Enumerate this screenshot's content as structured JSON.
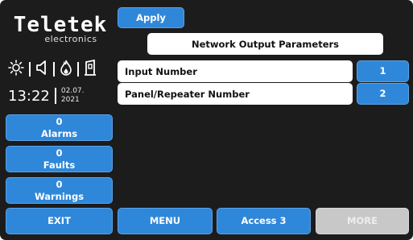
{
  "brand": {
    "name": "Teletek",
    "subtitle": "electronics"
  },
  "status_icons": [
    "sun-icon",
    "buzzer-icon",
    "fire-icon",
    "door-icon"
  ],
  "clock": {
    "time": "13:22",
    "date_line1": "02.07.",
    "date_line2": "2021"
  },
  "counters": {
    "alarms": {
      "count": "0",
      "label": "Alarms"
    },
    "faults": {
      "count": "0",
      "label": "Faults"
    },
    "warnings": {
      "count": "0",
      "label": "Warnings"
    }
  },
  "toolbar": {
    "apply_label": "Apply"
  },
  "page": {
    "title": "Network Output Parameters"
  },
  "params": [
    {
      "label": "Input Number",
      "value": "1"
    },
    {
      "label": "Panel/Repeater Number",
      "value": "2"
    }
  ],
  "footer": {
    "exit_label": "EXIT",
    "menu_label": "MENU",
    "access_label": "Access 3",
    "more_label": "MORE"
  },
  "colors": {
    "accent": "#2f87d9",
    "background": "#1c1c1c",
    "disabled": "#c8c8c8"
  }
}
